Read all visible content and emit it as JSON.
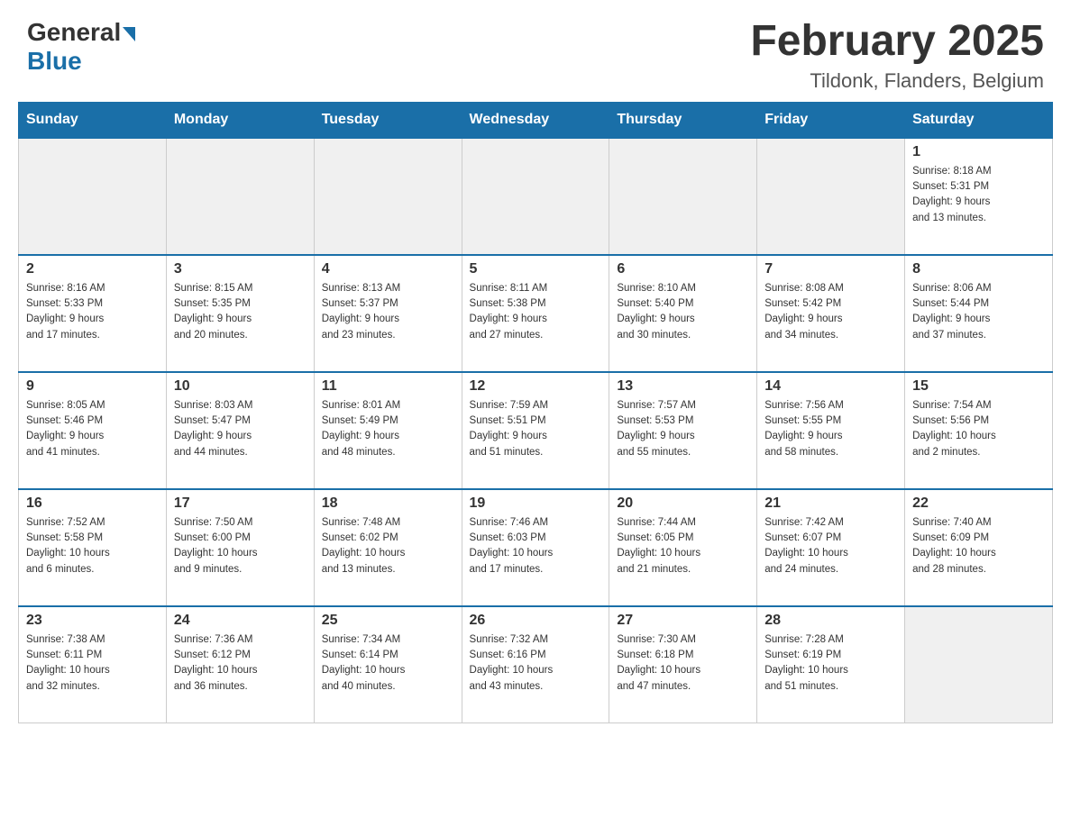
{
  "header": {
    "logo_general": "General",
    "logo_blue": "Blue",
    "title": "February 2025",
    "subtitle": "Tildonk, Flanders, Belgium"
  },
  "weekdays": [
    "Sunday",
    "Monday",
    "Tuesday",
    "Wednesday",
    "Thursday",
    "Friday",
    "Saturday"
  ],
  "weeks": [
    [
      {
        "day": "",
        "info": ""
      },
      {
        "day": "",
        "info": ""
      },
      {
        "day": "",
        "info": ""
      },
      {
        "day": "",
        "info": ""
      },
      {
        "day": "",
        "info": ""
      },
      {
        "day": "",
        "info": ""
      },
      {
        "day": "1",
        "info": "Sunrise: 8:18 AM\nSunset: 5:31 PM\nDaylight: 9 hours\nand 13 minutes."
      }
    ],
    [
      {
        "day": "2",
        "info": "Sunrise: 8:16 AM\nSunset: 5:33 PM\nDaylight: 9 hours\nand 17 minutes."
      },
      {
        "day": "3",
        "info": "Sunrise: 8:15 AM\nSunset: 5:35 PM\nDaylight: 9 hours\nand 20 minutes."
      },
      {
        "day": "4",
        "info": "Sunrise: 8:13 AM\nSunset: 5:37 PM\nDaylight: 9 hours\nand 23 minutes."
      },
      {
        "day": "5",
        "info": "Sunrise: 8:11 AM\nSunset: 5:38 PM\nDaylight: 9 hours\nand 27 minutes."
      },
      {
        "day": "6",
        "info": "Sunrise: 8:10 AM\nSunset: 5:40 PM\nDaylight: 9 hours\nand 30 minutes."
      },
      {
        "day": "7",
        "info": "Sunrise: 8:08 AM\nSunset: 5:42 PM\nDaylight: 9 hours\nand 34 minutes."
      },
      {
        "day": "8",
        "info": "Sunrise: 8:06 AM\nSunset: 5:44 PM\nDaylight: 9 hours\nand 37 minutes."
      }
    ],
    [
      {
        "day": "9",
        "info": "Sunrise: 8:05 AM\nSunset: 5:46 PM\nDaylight: 9 hours\nand 41 minutes."
      },
      {
        "day": "10",
        "info": "Sunrise: 8:03 AM\nSunset: 5:47 PM\nDaylight: 9 hours\nand 44 minutes."
      },
      {
        "day": "11",
        "info": "Sunrise: 8:01 AM\nSunset: 5:49 PM\nDaylight: 9 hours\nand 48 minutes."
      },
      {
        "day": "12",
        "info": "Sunrise: 7:59 AM\nSunset: 5:51 PM\nDaylight: 9 hours\nand 51 minutes."
      },
      {
        "day": "13",
        "info": "Sunrise: 7:57 AM\nSunset: 5:53 PM\nDaylight: 9 hours\nand 55 minutes."
      },
      {
        "day": "14",
        "info": "Sunrise: 7:56 AM\nSunset: 5:55 PM\nDaylight: 9 hours\nand 58 minutes."
      },
      {
        "day": "15",
        "info": "Sunrise: 7:54 AM\nSunset: 5:56 PM\nDaylight: 10 hours\nand 2 minutes."
      }
    ],
    [
      {
        "day": "16",
        "info": "Sunrise: 7:52 AM\nSunset: 5:58 PM\nDaylight: 10 hours\nand 6 minutes."
      },
      {
        "day": "17",
        "info": "Sunrise: 7:50 AM\nSunset: 6:00 PM\nDaylight: 10 hours\nand 9 minutes."
      },
      {
        "day": "18",
        "info": "Sunrise: 7:48 AM\nSunset: 6:02 PM\nDaylight: 10 hours\nand 13 minutes."
      },
      {
        "day": "19",
        "info": "Sunrise: 7:46 AM\nSunset: 6:03 PM\nDaylight: 10 hours\nand 17 minutes."
      },
      {
        "day": "20",
        "info": "Sunrise: 7:44 AM\nSunset: 6:05 PM\nDaylight: 10 hours\nand 21 minutes."
      },
      {
        "day": "21",
        "info": "Sunrise: 7:42 AM\nSunset: 6:07 PM\nDaylight: 10 hours\nand 24 minutes."
      },
      {
        "day": "22",
        "info": "Sunrise: 7:40 AM\nSunset: 6:09 PM\nDaylight: 10 hours\nand 28 minutes."
      }
    ],
    [
      {
        "day": "23",
        "info": "Sunrise: 7:38 AM\nSunset: 6:11 PM\nDaylight: 10 hours\nand 32 minutes."
      },
      {
        "day": "24",
        "info": "Sunrise: 7:36 AM\nSunset: 6:12 PM\nDaylight: 10 hours\nand 36 minutes."
      },
      {
        "day": "25",
        "info": "Sunrise: 7:34 AM\nSunset: 6:14 PM\nDaylight: 10 hours\nand 40 minutes."
      },
      {
        "day": "26",
        "info": "Sunrise: 7:32 AM\nSunset: 6:16 PM\nDaylight: 10 hours\nand 43 minutes."
      },
      {
        "day": "27",
        "info": "Sunrise: 7:30 AM\nSunset: 6:18 PM\nDaylight: 10 hours\nand 47 minutes."
      },
      {
        "day": "28",
        "info": "Sunrise: 7:28 AM\nSunset: 6:19 PM\nDaylight: 10 hours\nand 51 minutes."
      },
      {
        "day": "",
        "info": ""
      }
    ]
  ]
}
